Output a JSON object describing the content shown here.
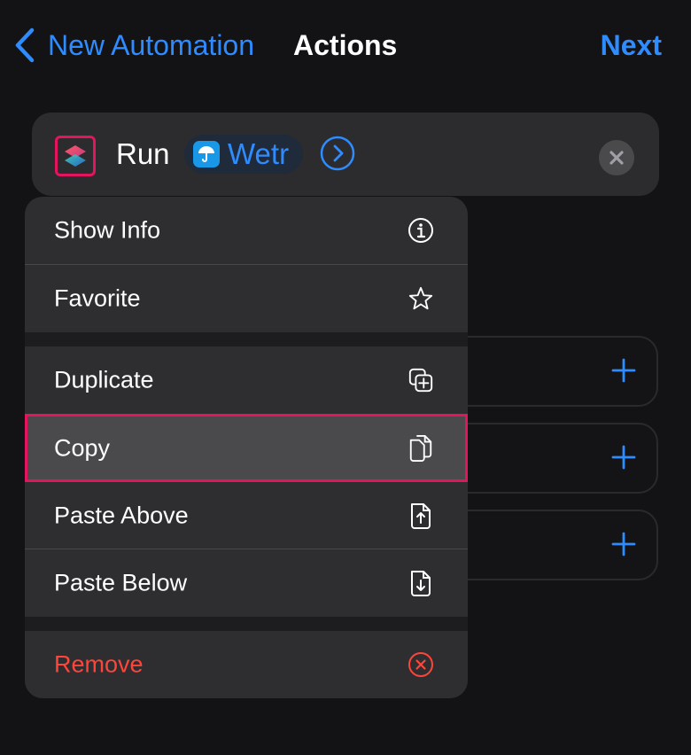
{
  "header": {
    "back_label": "New Automation",
    "title": "Actions",
    "next_label": "Next"
  },
  "action": {
    "run_label": "Run",
    "shortcut_name": "Wetr",
    "icons": {
      "app": "shortcuts-icon",
      "token": "umbrella-icon",
      "expand": "chevron-right-circle-icon",
      "clear": "close-circle-icon"
    }
  },
  "menu": {
    "items": [
      {
        "label": "Show Info",
        "icon": "info-circle-icon"
      },
      {
        "label": "Favorite",
        "icon": "star-icon"
      },
      {
        "label": "Duplicate",
        "icon": "duplicate-plus-icon"
      },
      {
        "label": "Copy",
        "icon": "copy-documents-icon",
        "highlighted": true
      },
      {
        "label": "Paste Above",
        "icon": "document-arrow-up-icon"
      },
      {
        "label": "Paste Below",
        "icon": "document-arrow-down-icon"
      },
      {
        "label": "Remove",
        "icon": "remove-circle-icon",
        "destructive": true
      }
    ]
  },
  "colors": {
    "background": "#131316",
    "accent": "#2f8cff",
    "destructive": "#ff453a",
    "highlight_border": "#e5145e",
    "menu_bg": "#2e2e31",
    "card_bg": "#2c2c2e"
  }
}
